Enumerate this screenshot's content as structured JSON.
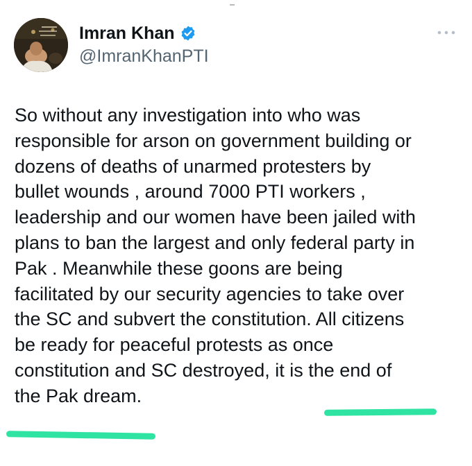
{
  "author": {
    "name": "Imran Khan",
    "handle": "@ImranKhanPTI",
    "verified": true,
    "avatar_icon": "profile-photo"
  },
  "header": {
    "more_icon": "more-horizontal-icon"
  },
  "tweet": {
    "lines": [
      "So without any investigation into who was",
      "responsible for arson on government building or",
      "dozens of deaths of unarmed protesters by",
      "bullet wounds , around 7000 PTI workers ,",
      "leadership and our women have been jailed with",
      "plans to ban the largest and only federal party in",
      "Pak . Meanwhile these goons are being",
      "facilitated by our security agencies to take over",
      "the SC and subvert the constitution. All citizens",
      "be ready for peaceful protests as once",
      "constitution and SC destroyed, it is the end of",
      "the Pak dream."
    ]
  },
  "colors": {
    "verified_badge": "#1d9bf0",
    "highlight": "#2fe3a3",
    "secondary_text": "#536471",
    "text": "#0f1419"
  }
}
